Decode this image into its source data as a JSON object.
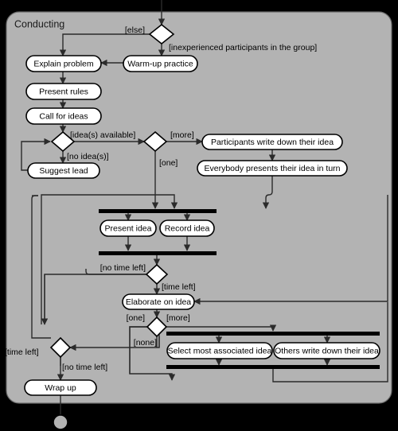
{
  "diagram": {
    "type": "uml-activity-diagram",
    "frame_title": "Conducting",
    "background_color": "#000000",
    "frame_color": "#b3b3b3",
    "node_fill": "#ffffff",
    "line_color": "#2b2b2b",
    "activities": [
      {
        "id": "explain-problem",
        "label": "Explain problem"
      },
      {
        "id": "warm-up-practice",
        "label": "Warm-up practice"
      },
      {
        "id": "present-rules",
        "label": "Present rules"
      },
      {
        "id": "call-for-ideas",
        "label": "Call for ideas"
      },
      {
        "id": "suggest-lead",
        "label": "Suggest lead"
      },
      {
        "id": "participants-write",
        "label": "Participants write down their idea"
      },
      {
        "id": "everybody-presents",
        "label": "Everybody presents their idea in turn"
      },
      {
        "id": "present-idea",
        "label": "Present idea"
      },
      {
        "id": "record-idea",
        "label": "Record idea"
      },
      {
        "id": "elaborate-on-idea",
        "label": "Elaborate on idea"
      },
      {
        "id": "select-most",
        "label": "Select most associated idea"
      },
      {
        "id": "others-write",
        "label": "Others write down their idea"
      },
      {
        "id": "wrap-up",
        "label": "Wrap up"
      }
    ],
    "guards": [
      {
        "id": "guard-else",
        "text": "[else]"
      },
      {
        "id": "guard-inexperienced",
        "text": "[inexperienced participants in the group]"
      },
      {
        "id": "guard-ideas-avail",
        "text": "[idea(s) available]"
      },
      {
        "id": "guard-no-ideas",
        "text": "[no idea(s)]"
      },
      {
        "id": "guard-more-1",
        "text": "[more]"
      },
      {
        "id": "guard-one-1",
        "text": "[one]"
      },
      {
        "id": "guard-no-time-1",
        "text": "[no time left]"
      },
      {
        "id": "guard-time-left-1",
        "text": "[time left]"
      },
      {
        "id": "guard-one-2",
        "text": "[one]"
      },
      {
        "id": "guard-more-2",
        "text": "[more]"
      },
      {
        "id": "guard-none",
        "text": "[none]"
      },
      {
        "id": "guard-time-left-2",
        "text": "[time left]"
      },
      {
        "id": "guard-no-time-2",
        "text": "[no time left]"
      }
    ],
    "control_nodes": {
      "decision_1": "decision-experience",
      "merge_1": "merge-ideas",
      "decision_2": "decision-idea-count",
      "fork_1": "fork-present-record",
      "join_1": "join-present-record",
      "decision_3": "decision-time-after-record",
      "decision_4": "decision-elaborate-count",
      "fork_2": "fork-select-others",
      "join_2": "join-select-others",
      "merge_2": "merge-time-check",
      "final": "activity-final-node"
    }
  }
}
